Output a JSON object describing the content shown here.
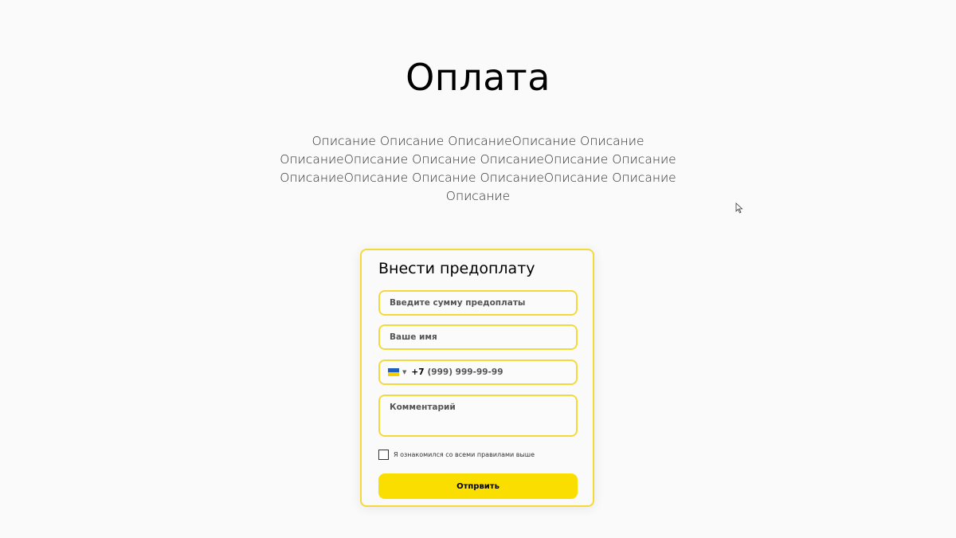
{
  "page": {
    "title": "Оплата",
    "description": "Описание Описание ОписаниеОписание Описание ОписаниеОписание Описание ОписаниеОписание Описание ОписаниеОписание Описание ОписаниеОписание Описание Описание"
  },
  "form": {
    "title": "Внести предоплату",
    "amount_placeholder": "Введите сумму предоплаты",
    "name_placeholder": "Ваше имя",
    "phone_prefix": "+7",
    "phone_placeholder": "(999) 999-99-99",
    "comment_placeholder": "Комментарий",
    "agree_label": "Я ознакомился со всеми правилами выше",
    "submit_label": "Отпрвить"
  },
  "colors": {
    "accent": "#fade00",
    "border": "#f5d93a",
    "background": "#fafafa"
  },
  "icons": {
    "country": "flag-icon",
    "dropdown": "chevron-down-icon",
    "cursor": "mouse-cursor-icon"
  }
}
